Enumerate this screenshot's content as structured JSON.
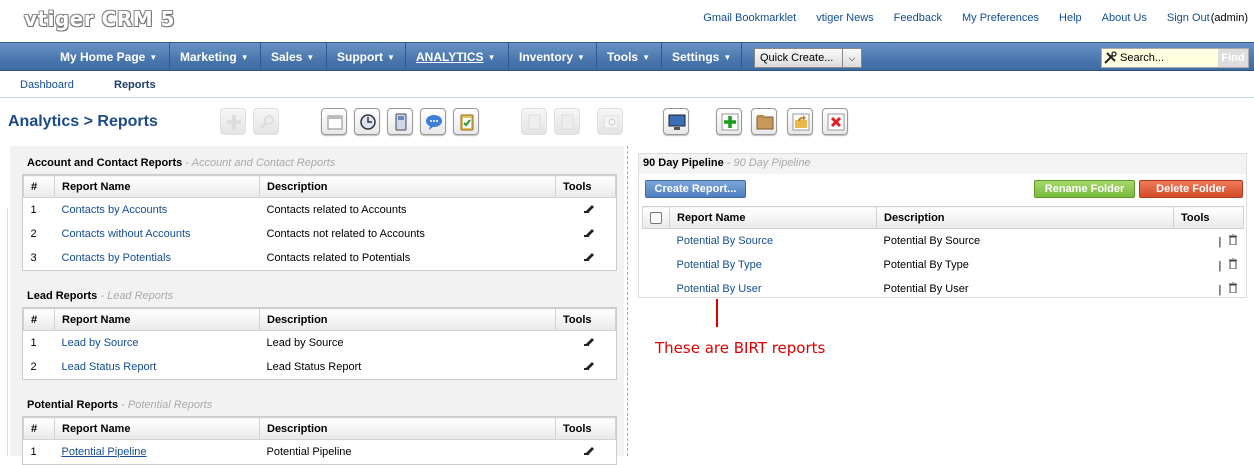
{
  "app": {
    "logo": "vtiger CRM 5"
  },
  "toplinks": [
    "Gmail Bookmarklet",
    "vtiger News",
    "Feedback",
    "My Preferences",
    "Help",
    "About Us",
    "Sign Out"
  ],
  "user": "(admin)",
  "nav": {
    "items": [
      "My Home Page",
      "Marketing",
      "Sales",
      "Support",
      "ANALYTICS",
      "Inventory",
      "Tools",
      "Settings"
    ],
    "caret": "▼",
    "quick_create": "Quick Create...",
    "dropdown_glyph": "⌵",
    "search_placeholder": "Search...",
    "find": "Find"
  },
  "subnav": {
    "dashboard": "Dashboard",
    "reports": "Reports"
  },
  "page": {
    "module": "Analytics",
    "separator": ">",
    "title": "Reports"
  },
  "columns": {
    "num": "#",
    "name": "Report Name",
    "desc": "Description",
    "tools": "Tools"
  },
  "sections": [
    {
      "title": "Account and Contact Reports",
      "subtitle": "- Account and Contact Reports",
      "rows": [
        {
          "num": "1",
          "name": "Contacts by Accounts",
          "desc": "Contacts related to Accounts"
        },
        {
          "num": "2",
          "name": "Contacts without Accounts",
          "desc": "Contacts not related to Accounts"
        },
        {
          "num": "3",
          "name": "Contacts by Potentials",
          "desc": "Contacts related to Potentials"
        }
      ]
    },
    {
      "title": "Lead Reports",
      "subtitle": "- Lead Reports",
      "rows": [
        {
          "num": "1",
          "name": "Lead by Source",
          "desc": "Lead by Source"
        },
        {
          "num": "2",
          "name": "Lead Status Report",
          "desc": "Lead Status Report"
        }
      ]
    },
    {
      "title": "Potential Reports",
      "subtitle": "- Potential Reports",
      "rows": [
        {
          "num": "1",
          "name": "Potential Pipeline",
          "desc": "Potential Pipeline"
        }
      ]
    }
  ],
  "folder": {
    "title": "90 Day Pipeline",
    "subtitle": "- 90 Day Pipeline",
    "create_label": "Create Report...",
    "rename_label": "Rename Folder",
    "delete_label": "Delete Folder",
    "tools_sep": "|",
    "rows": [
      {
        "name": "Potential By Source",
        "desc": "Potential By Source"
      },
      {
        "name": "Potential By Type",
        "desc": "Potential By Type"
      },
      {
        "name": "Potential By User",
        "desc": "Potential By User"
      }
    ]
  },
  "annotation": "These are BIRT reports",
  "colors": {
    "nav": "#4a77ae",
    "link": "#134e92",
    "annotation": "#e00000"
  }
}
